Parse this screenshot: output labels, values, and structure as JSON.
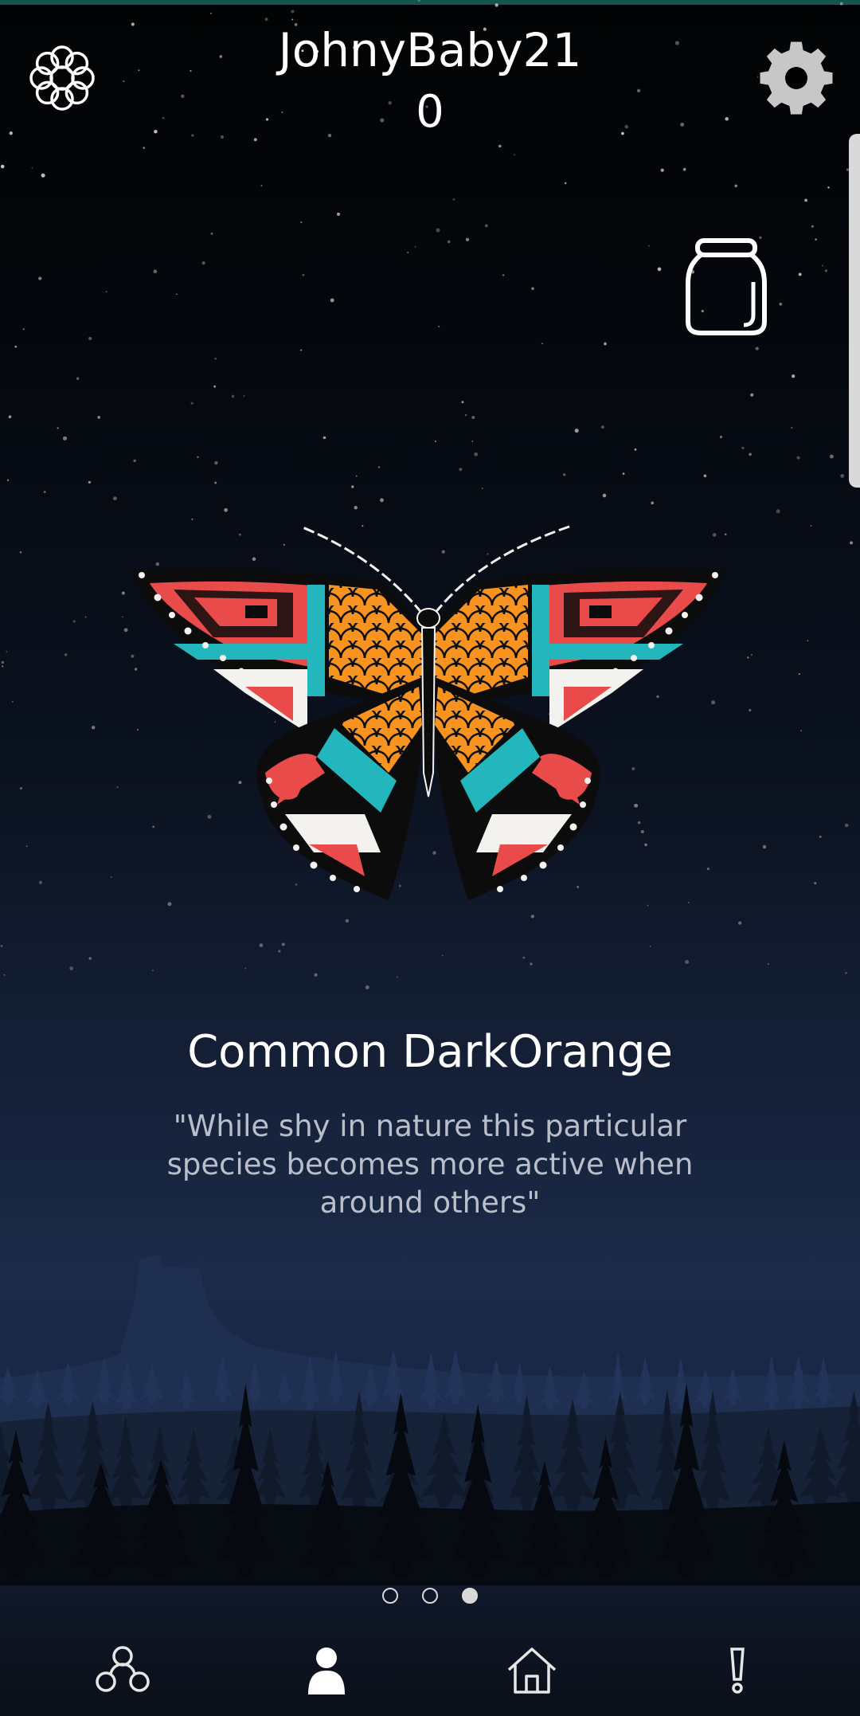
{
  "header": {
    "username": "JohnyBaby21",
    "score": "0"
  },
  "icons": {
    "flower": "flower-outline-icon",
    "settings": "gear-icon",
    "jar": "jar-icon"
  },
  "butterfly": {
    "name": "Common DarkOrange",
    "description": "\"While shy in nature this particular species becomes more active when around others\"",
    "colors": {
      "orange": "#f7931e",
      "red": "#e94b4b",
      "teal": "#23b7bd",
      "black": "#0c0c0c",
      "white": "#f4f2ee"
    }
  },
  "pagination": {
    "count": 3,
    "active_index": 2
  },
  "navbar": {
    "items": [
      {
        "name": "community-icon"
      },
      {
        "name": "profile-icon",
        "active": true
      },
      {
        "name": "home-icon"
      },
      {
        "name": "alert-icon"
      }
    ]
  }
}
